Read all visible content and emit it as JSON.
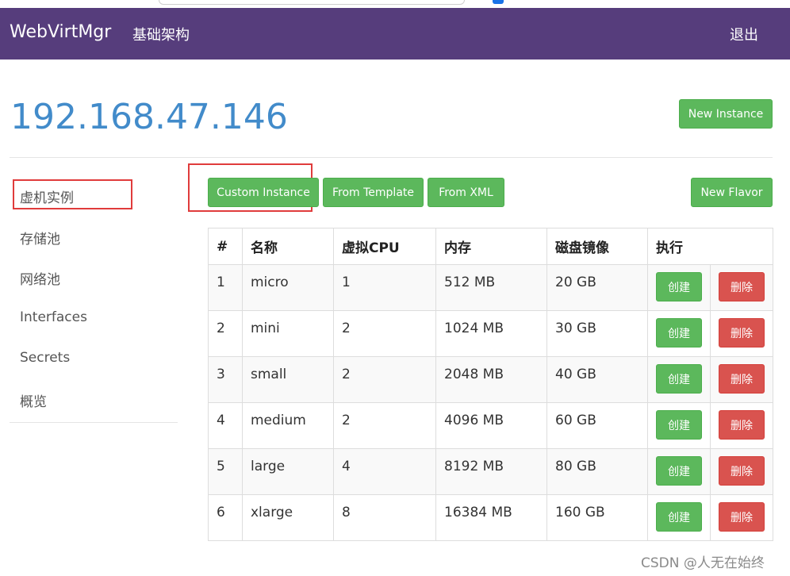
{
  "navbar": {
    "brand": "WebVirtMgr",
    "link": "基础架构",
    "logout": "退出"
  },
  "host": {
    "title": "192.168.47.146"
  },
  "header_buttons": {
    "new_instance": "New Instance"
  },
  "actions": {
    "custom_instance": "Custom Instance",
    "from_template": "From Template",
    "from_xml": "From XML",
    "new_flavor": "New Flavor"
  },
  "sidebar": {
    "items": [
      {
        "label": "虚机实例"
      },
      {
        "label": "存储池"
      },
      {
        "label": "网络池"
      },
      {
        "label": "Interfaces"
      },
      {
        "label": "Secrets"
      },
      {
        "label": "概览"
      }
    ]
  },
  "table": {
    "headers": [
      "#",
      "名称",
      "虚拟CPU",
      "内存",
      "磁盘镜像",
      "执行"
    ],
    "rows": [
      {
        "num": "1",
        "name": "micro",
        "cpu": "1",
        "mem": "512 MB",
        "disk": "20 GB",
        "create": "创建",
        "delete": "删除"
      },
      {
        "num": "2",
        "name": "mini",
        "cpu": "2",
        "mem": "1024 MB",
        "disk": "30 GB",
        "create": "创建",
        "delete": "删除"
      },
      {
        "num": "3",
        "name": "small",
        "cpu": "2",
        "mem": "2048 MB",
        "disk": "40 GB",
        "create": "创建",
        "delete": "删除"
      },
      {
        "num": "4",
        "name": "medium",
        "cpu": "2",
        "mem": "4096 MB",
        "disk": "60 GB",
        "create": "创建",
        "delete": "删除"
      },
      {
        "num": "5",
        "name": "large",
        "cpu": "4",
        "mem": "8192 MB",
        "disk": "80 GB",
        "create": "创建",
        "delete": "删除"
      },
      {
        "num": "6",
        "name": "xlarge",
        "cpu": "8",
        "mem": "16384 MB",
        "disk": "160 GB",
        "create": "创建",
        "delete": "删除"
      }
    ]
  },
  "watermark": "CSDN @人无在始终",
  "colors": {
    "navbar": "#563d7c",
    "accent": "#428bca",
    "success": "#5cb85c",
    "danger": "#d9534f",
    "highlight": "#e03c3c"
  }
}
